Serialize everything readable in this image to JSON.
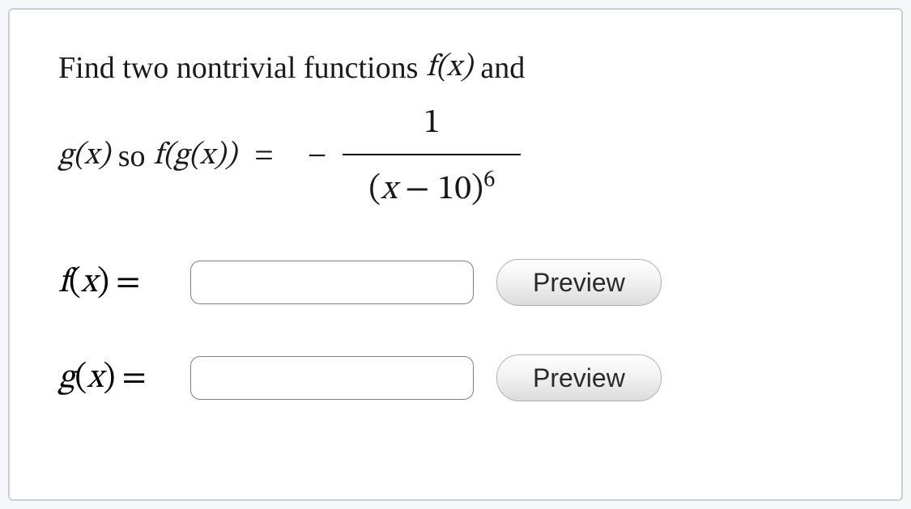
{
  "question": {
    "prefix_text": "Find two nontrivial functions",
    "fx": "f(x)",
    "and_text": "and",
    "gx": "g(x)",
    "so_text": "so",
    "fgx": "f(g(x))",
    "equals": "=",
    "neg_sign": "−",
    "fraction": {
      "numerator": "1",
      "den_open": "(",
      "den_var": "x",
      "den_minus": "−",
      "den_const": "10",
      "den_close": ")",
      "den_exp": "6"
    }
  },
  "rows": {
    "f": {
      "label_fn": "f",
      "label_open": "(",
      "label_var": "x",
      "label_close": ")",
      "label_eq": "=",
      "input_value": "",
      "preview_label": "Preview"
    },
    "g": {
      "label_fn": "g",
      "label_open": "(",
      "label_var": "x",
      "label_close": ")",
      "label_eq": "=",
      "input_value": "",
      "preview_label": "Preview"
    }
  }
}
